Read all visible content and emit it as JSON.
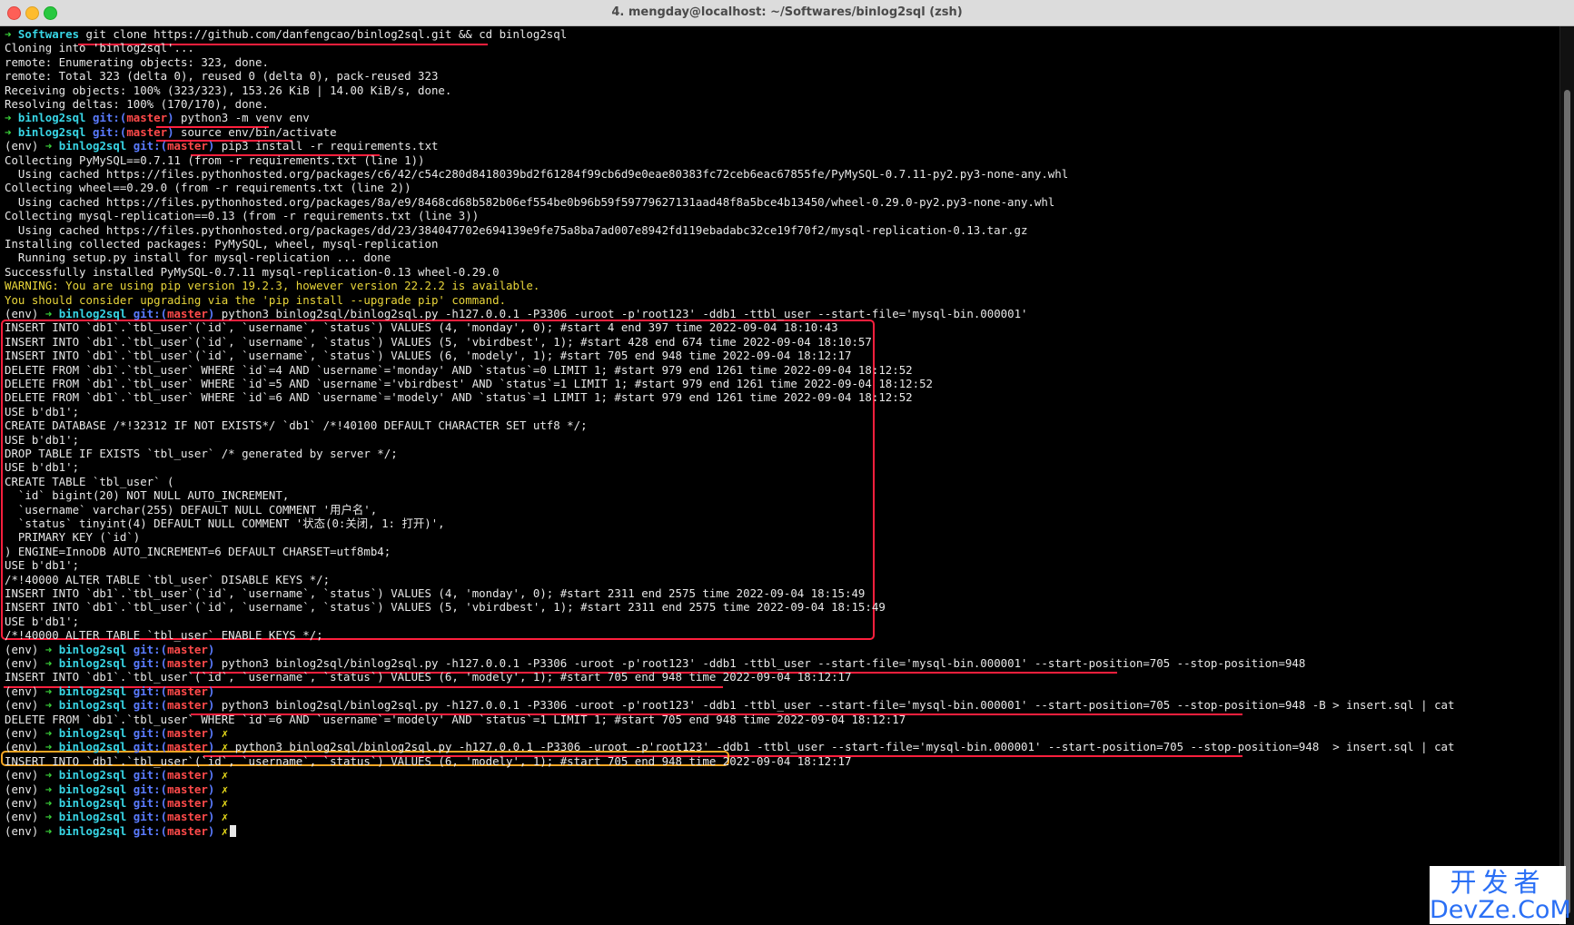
{
  "window": {
    "title": "4. mengday@localhost: ~/Softwares/binlog2sql (zsh)",
    "colors": {
      "background": "#000000",
      "prompt_arrow": "#3ad33a",
      "directory": "#38d6e6",
      "git_label": "#5a7bff",
      "branch": "#ff4a4a",
      "dirty_marker": "#f0e21a",
      "warning": "#e8d53a",
      "highlight_red": "#ff1f3d",
      "highlight_yellow": "#f5a623"
    }
  },
  "lines": [
    {
      "type": "prompt",
      "env": "",
      "dir": "Softwares",
      "git": "",
      "branch": "",
      "cmd": "git clone https://github.com/danfengcao/binlog2sql.git && cd binlog2sql",
      "dirty": ""
    },
    {
      "type": "out",
      "text": "Cloning into 'binlog2sql'..."
    },
    {
      "type": "out",
      "text": "remote: Enumerating objects: 323, done."
    },
    {
      "type": "out",
      "text": "remote: Total 323 (delta 0), reused 0 (delta 0), pack-reused 323"
    },
    {
      "type": "out",
      "text": "Receiving objects: 100% (323/323), 153.26 KiB | 14.00 KiB/s, done."
    },
    {
      "type": "out",
      "text": "Resolving deltas: 100% (170/170), done."
    },
    {
      "type": "prompt",
      "env": "",
      "dir": "binlog2sql",
      "git": "git:(",
      "branch": "master",
      "cmd": "python3 -m venv env",
      "dirty": ""
    },
    {
      "type": "prompt",
      "env": "",
      "dir": "binlog2sql",
      "git": "git:(",
      "branch": "master",
      "cmd": "source env/bin/activate",
      "dirty": ""
    },
    {
      "type": "prompt",
      "env": "(env) ",
      "dir": "binlog2sql",
      "git": "git:(",
      "branch": "master",
      "cmd": "pip3 install -r requirements.txt",
      "dirty": ""
    },
    {
      "type": "out",
      "text": "Collecting PyMySQL==0.7.11 (from -r requirements.txt (line 1))"
    },
    {
      "type": "out",
      "text": "  Using cached https://files.pythonhosted.org/packages/c6/42/c54c280d8418039bd2f61284f99cb6d9e0eae80383fc72ceb6eac67855fe/PyMySQL-0.7.11-py2.py3-none-any.whl"
    },
    {
      "type": "out",
      "text": "Collecting wheel==0.29.0 (from -r requirements.txt (line 2))"
    },
    {
      "type": "out",
      "text": "  Using cached https://files.pythonhosted.org/packages/8a/e9/8468cd68b582b06ef554be0b96b59f59779627131aad48f8a5bce4b13450/wheel-0.29.0-py2.py3-none-any.whl"
    },
    {
      "type": "out",
      "text": "Collecting mysql-replication==0.13 (from -r requirements.txt (line 3))"
    },
    {
      "type": "out",
      "text": "  Using cached https://files.pythonhosted.org/packages/dd/23/384047702e694139e9fe75a8ba7ad007e8942fd119ebadabc32ce19f70f2/mysql-replication-0.13.tar.gz"
    },
    {
      "type": "out",
      "text": "Installing collected packages: PyMySQL, wheel, mysql-replication"
    },
    {
      "type": "out",
      "text": "  Running setup.py install for mysql-replication ... done"
    },
    {
      "type": "out",
      "text": "Successfully installed PyMySQL-0.7.11 mysql-replication-0.13 wheel-0.29.0"
    },
    {
      "type": "warn",
      "text": "WARNING: You are using pip version 19.2.3, however version 22.2.2 is available."
    },
    {
      "type": "warn",
      "text": "You should consider upgrading via the 'pip install --upgrade pip' command."
    },
    {
      "type": "prompt",
      "env": "(env) ",
      "dir": "binlog2sql",
      "git": "git:(",
      "branch": "master",
      "cmd": "python3 binlog2sql/binlog2sql.py -h127.0.0.1 -P3306 -uroot -p'root123' -ddb1 -ttbl_user --start-file='mysql-bin.000001'",
      "dirty": ""
    },
    {
      "type": "out",
      "text": "INSERT INTO `db1`.`tbl_user`(`id`, `username`, `status`) VALUES (4, 'monday', 0); #start 4 end 397 time 2022-09-04 18:10:43"
    },
    {
      "type": "out",
      "text": "INSERT INTO `db1`.`tbl_user`(`id`, `username`, `status`) VALUES (5, 'vbirdbest', 1); #start 428 end 674 time 2022-09-04 18:10:57"
    },
    {
      "type": "out",
      "text": "INSERT INTO `db1`.`tbl_user`(`id`, `username`, `status`) VALUES (6, 'modely', 1); #start 705 end 948 time 2022-09-04 18:12:17"
    },
    {
      "type": "out",
      "text": "DELETE FROM `db1`.`tbl_user` WHERE `id`=4 AND `username`='monday' AND `status`=0 LIMIT 1; #start 979 end 1261 time 2022-09-04 18:12:52"
    },
    {
      "type": "out",
      "text": "DELETE FROM `db1`.`tbl_user` WHERE `id`=5 AND `username`='vbirdbest' AND `status`=1 LIMIT 1; #start 979 end 1261 time 2022-09-04 18:12:52"
    },
    {
      "type": "out",
      "text": "DELETE FROM `db1`.`tbl_user` WHERE `id`=6 AND `username`='modely' AND `status`=1 LIMIT 1; #start 979 end 1261 time 2022-09-04 18:12:52"
    },
    {
      "type": "out",
      "text": "USE b'db1';"
    },
    {
      "type": "out",
      "text": "CREATE DATABASE /*!32312 IF NOT EXISTS*/ `db1` /*!40100 DEFAULT CHARACTER SET utf8 */;"
    },
    {
      "type": "out",
      "text": "USE b'db1';"
    },
    {
      "type": "out",
      "text": "DROP TABLE IF EXISTS `tbl_user` /* generated by server */;"
    },
    {
      "type": "out",
      "text": "USE b'db1';"
    },
    {
      "type": "out",
      "text": "CREATE TABLE `tbl_user` ("
    },
    {
      "type": "out",
      "text": "  `id` bigint(20) NOT NULL AUTO_INCREMENT,"
    },
    {
      "type": "out",
      "text": "  `username` varchar(255) DEFAULT NULL COMMENT '用户名',"
    },
    {
      "type": "out",
      "text": "  `status` tinyint(4) DEFAULT NULL COMMENT '状态(0:关闭, 1: 打开)',"
    },
    {
      "type": "out",
      "text": "  PRIMARY KEY (`id`)"
    },
    {
      "type": "out",
      "text": ") ENGINE=InnoDB AUTO_INCREMENT=6 DEFAULT CHARSET=utf8mb4;"
    },
    {
      "type": "out",
      "text": "USE b'db1';"
    },
    {
      "type": "out",
      "text": "/*!40000 ALTER TABLE `tbl_user` DISABLE KEYS */;"
    },
    {
      "type": "out",
      "text": "INSERT INTO `db1`.`tbl_user`(`id`, `username`, `status`) VALUES (4, 'monday', 0); #start 2311 end 2575 time 2022-09-04 18:15:49"
    },
    {
      "type": "out",
      "text": "INSERT INTO `db1`.`tbl_user`(`id`, `username`, `status`) VALUES (5, 'vbirdbest', 1); #start 2311 end 2575 time 2022-09-04 18:15:49"
    },
    {
      "type": "out",
      "text": "USE b'db1';"
    },
    {
      "type": "out",
      "text": "/*!40000 ALTER TABLE `tbl_user` ENABLE KEYS */;"
    },
    {
      "type": "prompt",
      "env": "(env) ",
      "dir": "binlog2sql",
      "git": "git:(",
      "branch": "master",
      "cmd": "",
      "dirty": ""
    },
    {
      "type": "prompt",
      "env": "(env) ",
      "dir": "binlog2sql",
      "git": "git:(",
      "branch": "master",
      "cmd": "python3 binlog2sql/binlog2sql.py -h127.0.0.1 -P3306 -uroot -p'root123' -ddb1 -ttbl_user --start-file='mysql-bin.000001' --start-position=705 --stop-position=948",
      "dirty": ""
    },
    {
      "type": "out",
      "text": "INSERT INTO `db1`.`tbl_user`(`id`, `username`, `status`) VALUES (6, 'modely', 1); #start 705 end 948 time 2022-09-04 18:12:17"
    },
    {
      "type": "prompt",
      "env": "(env) ",
      "dir": "binlog2sql",
      "git": "git:(",
      "branch": "master",
      "cmd": "",
      "dirty": ""
    },
    {
      "type": "prompt",
      "env": "(env) ",
      "dir": "binlog2sql",
      "git": "git:(",
      "branch": "master",
      "cmd": "python3 binlog2sql/binlog2sql.py -h127.0.0.1 -P3306 -uroot -p'root123' -ddb1 -ttbl_user --start-file='mysql-bin.000001' --start-position=705 --stop-position=948 -B > insert.sql | cat",
      "dirty": ""
    },
    {
      "type": "out",
      "text": "DELETE FROM `db1`.`tbl_user` WHERE `id`=6 AND `username`='modely' AND `status`=1 LIMIT 1; #start 705 end 948 time 2022-09-04 18:12:17"
    },
    {
      "type": "prompt",
      "env": "(env) ",
      "dir": "binlog2sql",
      "git": "git:(",
      "branch": "master",
      "cmd": "",
      "dirty": "✗"
    },
    {
      "type": "prompt",
      "env": "(env) ",
      "dir": "binlog2sql",
      "git": "git:(",
      "branch": "master",
      "cmd": "python3 binlog2sql/binlog2sql.py -h127.0.0.1 -P3306 -uroot -p'root123' -ddb1 -ttbl_user --start-file='mysql-bin.000001' --start-position=705 --stop-position=948  > insert.sql | cat",
      "dirty": "✗"
    },
    {
      "type": "out",
      "text": "INSERT INTO `db1`.`tbl_user`(`id`, `username`, `status`) VALUES (6, 'modely', 1); #start 705 end 948 time 2022-09-04 18:12:17"
    },
    {
      "type": "prompt",
      "env": "(env) ",
      "dir": "binlog2sql",
      "git": "git:(",
      "branch": "master",
      "cmd": "",
      "dirty": "✗"
    },
    {
      "type": "prompt",
      "env": "(env) ",
      "dir": "binlog2sql",
      "git": "git:(",
      "branch": "master",
      "cmd": "",
      "dirty": "✗"
    },
    {
      "type": "prompt",
      "env": "(env) ",
      "dir": "binlog2sql",
      "git": "git:(",
      "branch": "master",
      "cmd": "",
      "dirty": "✗"
    },
    {
      "type": "prompt",
      "env": "(env) ",
      "dir": "binlog2sql",
      "git": "git:(",
      "branch": "master",
      "cmd": "",
      "dirty": "✗"
    },
    {
      "type": "prompt",
      "env": "(env) ",
      "dir": "binlog2sql",
      "git": "git:(",
      "branch": "master",
      "cmd": "",
      "dirty": "✗",
      "cursor": true
    }
  ],
  "watermark": {
    "top": "开发者",
    "bottom": "DevZe.CoM"
  }
}
